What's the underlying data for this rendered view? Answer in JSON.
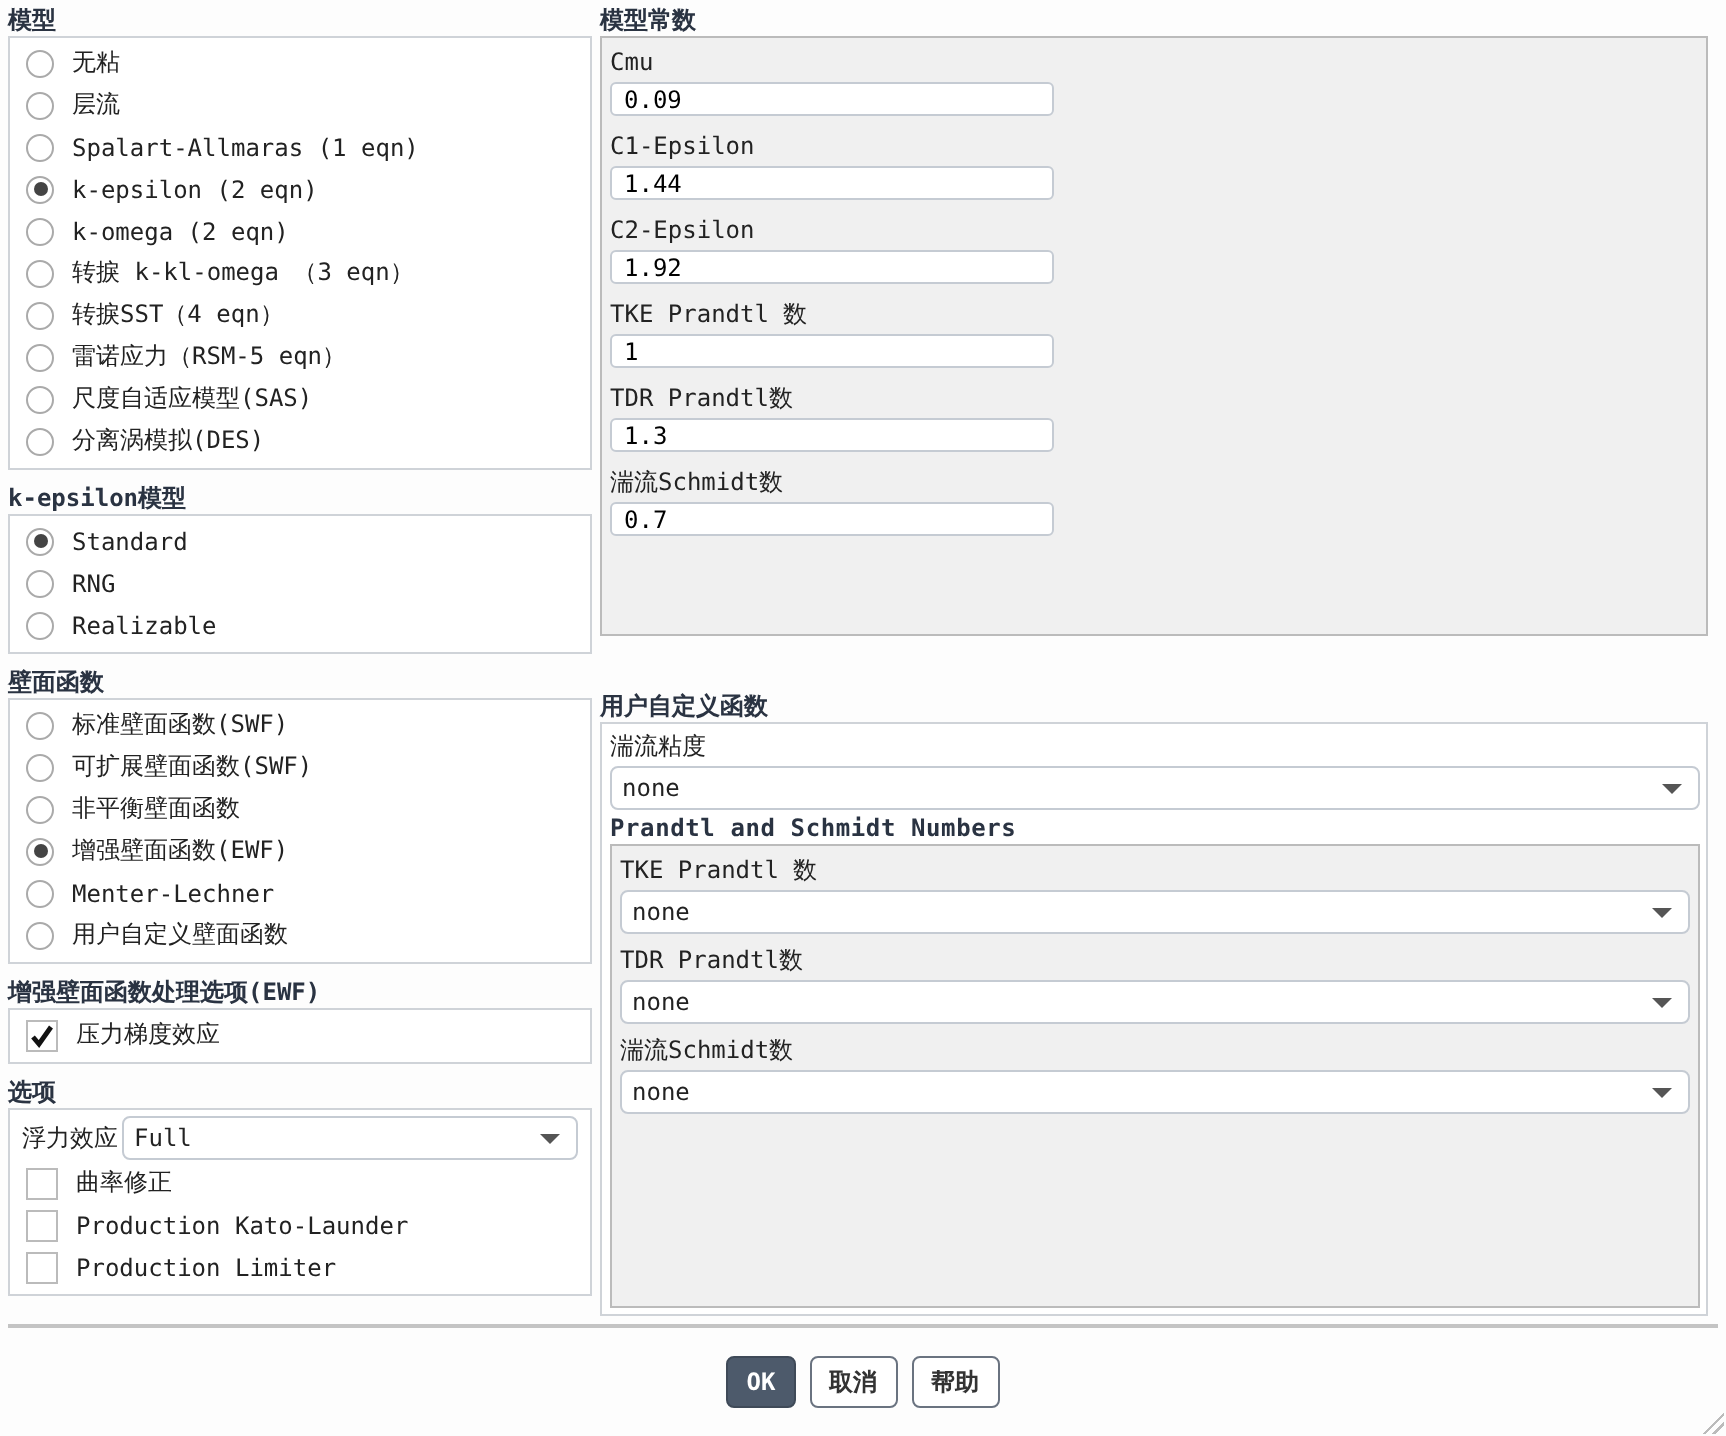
{
  "model": {
    "title": "模型",
    "options": [
      {
        "label": "无粘",
        "selected": false
      },
      {
        "label": "层流",
        "selected": false
      },
      {
        "label": "Spalart-Allmaras (1 eqn)",
        "selected": false
      },
      {
        "label": "k-epsilon (2 eqn)",
        "selected": true
      },
      {
        "label": "k-omega (2 eqn)",
        "selected": false
      },
      {
        "label": "转捩 k-kl-omega （3 eqn）",
        "selected": false
      },
      {
        "label": "转捩SST（4 eqn）",
        "selected": false
      },
      {
        "label": "雷诺应力（RSM-5 eqn）",
        "selected": false
      },
      {
        "label": "尺度自适应模型(SAS)",
        "selected": false
      },
      {
        "label": "分离涡模拟(DES)",
        "selected": false
      }
    ]
  },
  "k_epsilon_model": {
    "title": "k-epsilon模型",
    "options": [
      {
        "label": "Standard",
        "selected": true
      },
      {
        "label": "RNG",
        "selected": false
      },
      {
        "label": "Realizable",
        "selected": false
      }
    ]
  },
  "wall_function": {
    "title": "壁面函数",
    "options": [
      {
        "label": "标准壁面函数(SWF)",
        "selected": false
      },
      {
        "label": "可扩展壁面函数(SWF)",
        "selected": false
      },
      {
        "label": "非平衡壁面函数",
        "selected": false
      },
      {
        "label": "增强壁面函数(EWF)",
        "selected": true
      },
      {
        "label": "Menter-Lechner",
        "selected": false
      },
      {
        "label": "用户自定义壁面函数",
        "selected": false
      }
    ]
  },
  "ewf_options": {
    "title": "增强壁面函数处理选项(EWF)",
    "checkboxes": [
      {
        "label": "压力梯度效应",
        "checked": true
      }
    ]
  },
  "options": {
    "title": "选项",
    "buoyancy": {
      "label": "浮力效应",
      "value": "Full"
    },
    "checkboxes": [
      {
        "label": "曲率修正",
        "checked": false
      },
      {
        "label": "Production Kato-Launder",
        "checked": false
      },
      {
        "label": "Production Limiter",
        "checked": false
      }
    ]
  },
  "model_constants": {
    "title": "模型常数",
    "fields": [
      {
        "label": "Cmu",
        "value": "0.09"
      },
      {
        "label": "C1-Epsilon",
        "value": "1.44"
      },
      {
        "label": "C2-Epsilon",
        "value": "1.92"
      },
      {
        "label": "TKE Prandtl 数",
        "value": "1"
      },
      {
        "label": "TDR Prandtl数",
        "value": "1.3"
      },
      {
        "label": "湍流Schmidt数",
        "value": "0.7"
      }
    ]
  },
  "udf": {
    "title": "用户自定义函数",
    "turbulent_viscosity": {
      "label": "湍流粘度",
      "value": "none"
    },
    "prandtl_schmidt": {
      "title": "Prandtl and Schmidt Numbers",
      "fields": [
        {
          "label": "TKE Prandtl 数",
          "value": "none"
        },
        {
          "label": "TDR Prandtl数",
          "value": "none"
        },
        {
          "label": "湍流Schmidt数",
          "value": "none"
        }
      ]
    }
  },
  "buttons": [
    {
      "label": "OK",
      "kind": "primary"
    },
    {
      "label": "取消",
      "kind": "default"
    },
    {
      "label": "帮助",
      "kind": "default"
    }
  ]
}
